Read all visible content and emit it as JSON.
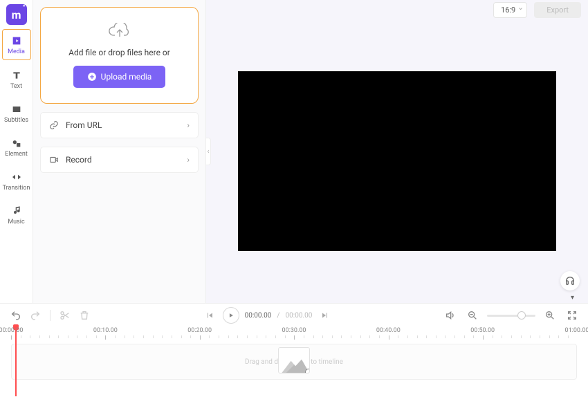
{
  "logo_initial": "m",
  "sidebar": {
    "media": "Media",
    "text": "Text",
    "subtitles": "Subtitles",
    "element": "Element",
    "transition": "Transition",
    "music": "Music"
  },
  "upload": {
    "hint": "Add file or drop files here or",
    "button": "Upload media"
  },
  "options": {
    "from_url": "From URL",
    "record": "Record"
  },
  "header": {
    "ratio": "16:9",
    "export": "Export"
  },
  "playback": {
    "current": "00:00.00",
    "sep": "/",
    "total": "00:00.00"
  },
  "ruler": {
    "stops": [
      "00:00.00",
      "00:10.00",
      "00:20.00",
      "00:30.00",
      "00:40.00",
      "00:50.00",
      "01:00.00"
    ]
  },
  "timeline": {
    "hint": "Drag and drop media to timeline"
  }
}
